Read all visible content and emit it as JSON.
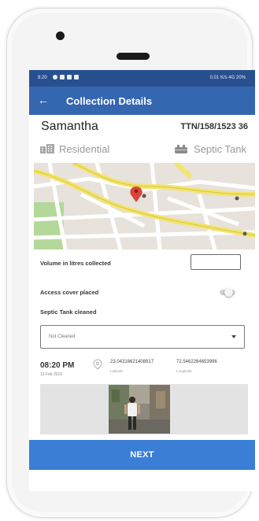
{
  "status_bar": {
    "time": "8:20",
    "right": "0.01 K/s  4G  20%"
  },
  "app_bar": {
    "back_icon": "arrow-left-icon",
    "title": "Collection Details"
  },
  "customer": {
    "name": "Samantha",
    "ticket": "TTN/158/1523 36"
  },
  "property": {
    "type": "Residential",
    "type_icon": "building-icon",
    "containment": "Septic Tank",
    "containment_icon": "septic-tank-icon"
  },
  "form": {
    "volume_label": "Volume in litres collected",
    "volume_value": "",
    "access_label": "Access cover placed",
    "access_placed": false,
    "cleaned_label": "Septic Tank cleaned",
    "cleaned_value": "Not Cleaned",
    "dropdown_icon": "caret-down-icon"
  },
  "capture": {
    "time": "08:20 PM",
    "date": "13 Feb 2019",
    "location_icon": "location-pin-icon",
    "latitude": "23.04318621408917",
    "latitude_label": "Latitude",
    "longitude": "72.5462264653996",
    "longitude_label": "Longitude"
  },
  "next_label": "NEXT",
  "colors": {
    "status_bar": "#285090",
    "app_bar": "#3566b0",
    "next_button": "#3a7ed6"
  }
}
